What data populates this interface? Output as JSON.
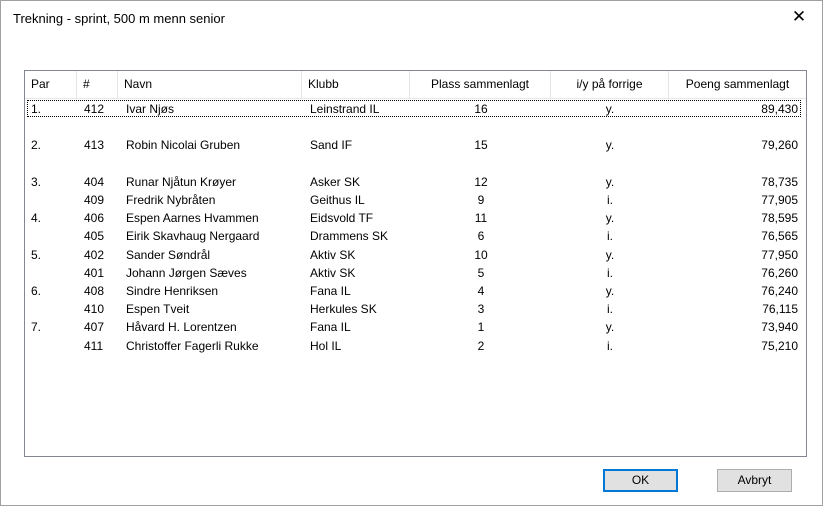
{
  "window": {
    "title": "Trekning - sprint, 500 m menn senior",
    "close_glyph": "✕"
  },
  "columns": {
    "par": "Par",
    "num": "#",
    "navn": "Navn",
    "klubb": "Klubb",
    "plass": "Plass sammenlagt",
    "iy": "i/y på forrige",
    "poeng": "Poeng sammenlagt"
  },
  "rows": [
    {
      "par": "1.",
      "num": "412",
      "navn": "Ivar Njøs",
      "klubb": "Leinstrand IL",
      "plass": "16",
      "iy": "y.",
      "poeng": "89,430"
    },
    {
      "par": "",
      "num": "",
      "navn": "",
      "klubb": "",
      "plass": "",
      "iy": "",
      "poeng": ""
    },
    {
      "par": "2.",
      "num": "413",
      "navn": "Robin Nicolai Gruben",
      "klubb": "Sand IF",
      "plass": "15",
      "iy": "y.",
      "poeng": "79,260"
    },
    {
      "par": "",
      "num": "",
      "navn": "",
      "klubb": "",
      "plass": "",
      "iy": "",
      "poeng": ""
    },
    {
      "par": "3.",
      "num": "404",
      "navn": "Runar Njåtun Krøyer",
      "klubb": "Asker SK",
      "plass": "12",
      "iy": "y.",
      "poeng": "78,735"
    },
    {
      "par": "",
      "num": "409",
      "navn": "Fredrik Nybråten",
      "klubb": "Geithus IL",
      "plass": "9",
      "iy": "i.",
      "poeng": "77,905"
    },
    {
      "par": "4.",
      "num": "406",
      "navn": "Espen Aarnes Hvammen",
      "klubb": "Eidsvold TF",
      "plass": "11",
      "iy": "y.",
      "poeng": "78,595"
    },
    {
      "par": "",
      "num": "405",
      "navn": "Eirik Skavhaug Nergaard",
      "klubb": "Drammens SK",
      "plass": "6",
      "iy": "i.",
      "poeng": "76,565"
    },
    {
      "par": "5.",
      "num": "402",
      "navn": "Sander Søndrål",
      "klubb": "Aktiv SK",
      "plass": "10",
      "iy": "y.",
      "poeng": "77,950"
    },
    {
      "par": "",
      "num": "401",
      "navn": "Johann Jørgen Sæves",
      "klubb": "Aktiv SK",
      "plass": "5",
      "iy": "i.",
      "poeng": "76,260"
    },
    {
      "par": "6.",
      "num": "408",
      "navn": "Sindre Henriksen",
      "klubb": "Fana IL",
      "plass": "4",
      "iy": "y.",
      "poeng": "76,240"
    },
    {
      "par": "",
      "num": "410",
      "navn": "Espen Tveit",
      "klubb": "Herkules SK",
      "plass": "3",
      "iy": "i.",
      "poeng": "76,115"
    },
    {
      "par": "7.",
      "num": "407",
      "navn": "Håvard H. Lorentzen",
      "klubb": "Fana IL",
      "plass": "1",
      "iy": "y.",
      "poeng": "73,940"
    },
    {
      "par": "",
      "num": "411",
      "navn": "Christoffer Fagerli Rukke",
      "klubb": "Hol IL",
      "plass": "2",
      "iy": "i.",
      "poeng": "75,210"
    }
  ],
  "buttons": {
    "ok": "OK",
    "cancel": "Avbryt"
  }
}
